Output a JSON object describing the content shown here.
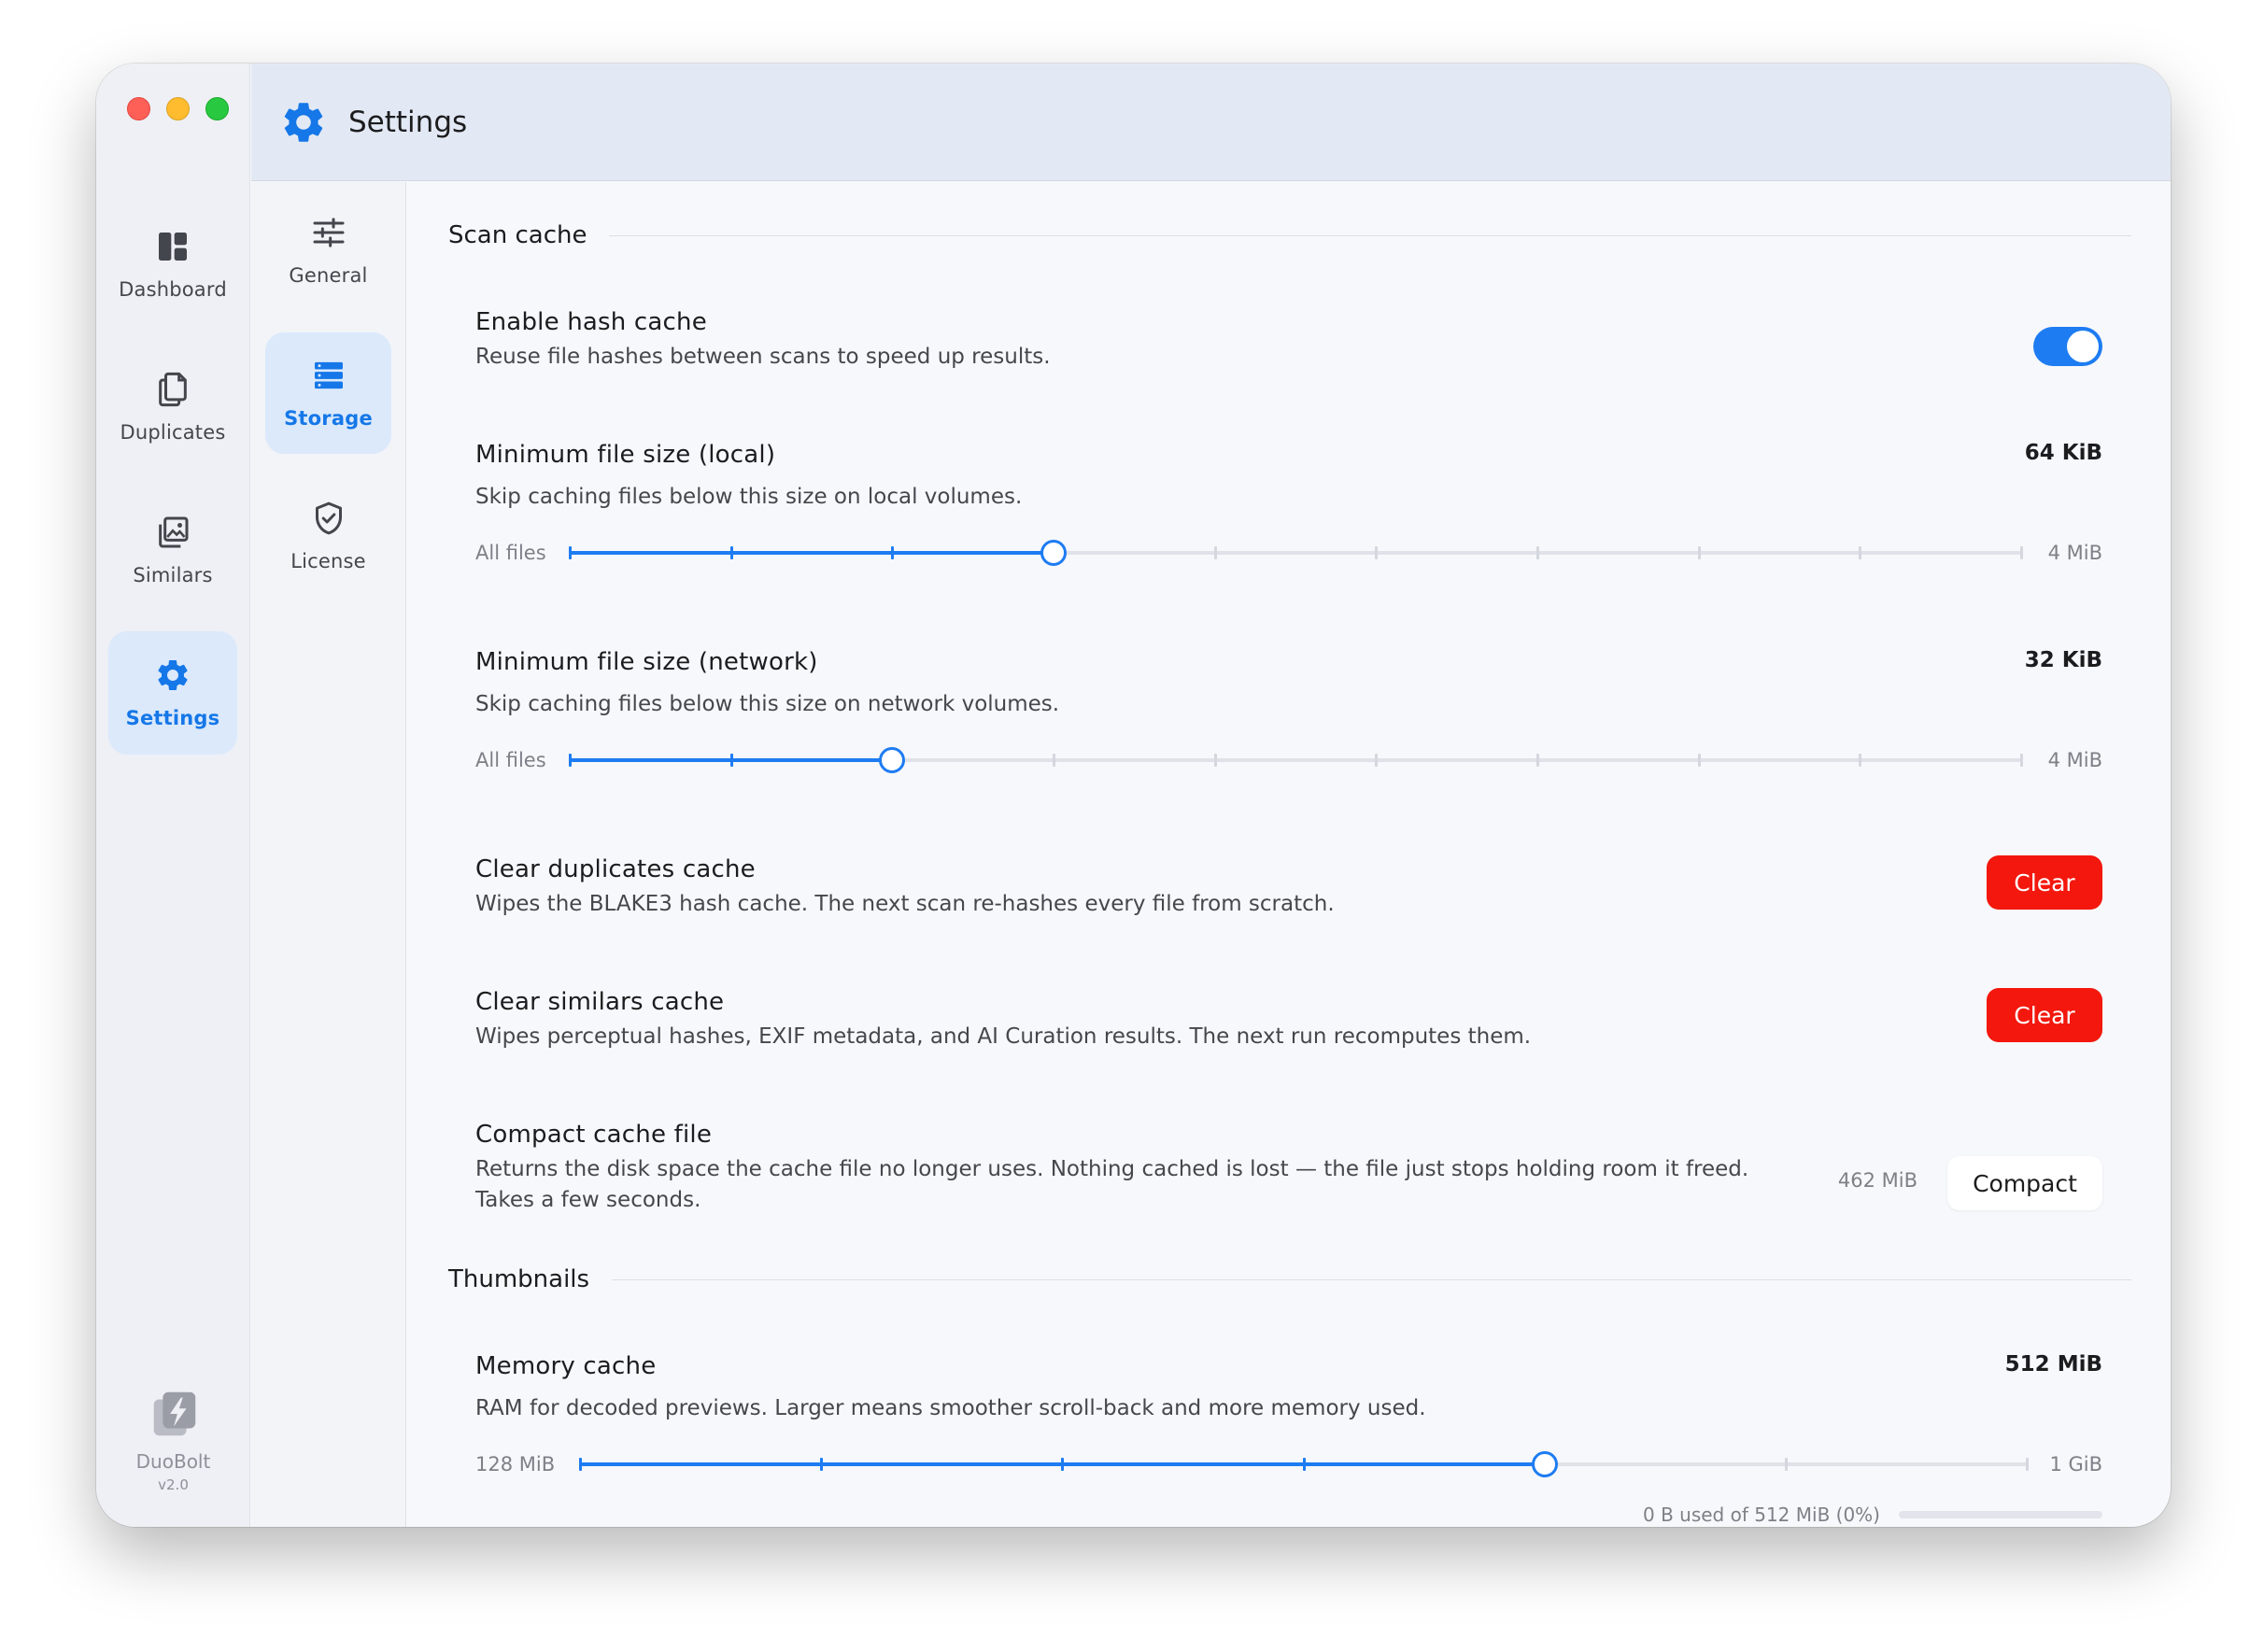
{
  "window": {
    "title": "Settings"
  },
  "sidebar": {
    "items": [
      {
        "label": "Dashboard",
        "icon": "dashboard-icon"
      },
      {
        "label": "Duplicates",
        "icon": "duplicates-icon"
      },
      {
        "label": "Similars",
        "icon": "similars-icon"
      },
      {
        "label": "Settings",
        "icon": "gear-icon",
        "active": true
      }
    ],
    "brand": {
      "name": "DuoBolt",
      "version": "v2.0",
      "icon": "duobolt-logo-icon"
    }
  },
  "subnav": {
    "items": [
      {
        "label": "General",
        "icon": "sliders-icon"
      },
      {
        "label": "Storage",
        "icon": "storage-icon",
        "active": true
      },
      {
        "label": "License",
        "icon": "shield-check-icon"
      }
    ]
  },
  "scan_cache": {
    "title": "Scan cache",
    "hash_cache": {
      "title": "Enable hash cache",
      "desc": "Reuse file hashes between scans to speed up results.",
      "enabled": true
    },
    "min_local": {
      "title": "Minimum file size (local)",
      "desc": "Skip caching files below this size on local volumes.",
      "value": "64 KiB",
      "min_label": "All files",
      "max_label": "4 MiB",
      "stops": 10,
      "position": 3
    },
    "min_network": {
      "title": "Minimum file size (network)",
      "desc": "Skip caching files below this size on network volumes.",
      "value": "32 KiB",
      "min_label": "All files",
      "max_label": "4 MiB",
      "stops": 10,
      "position": 2
    },
    "clear_duplicates": {
      "title": "Clear duplicates cache",
      "desc": "Wipes the BLAKE3 hash cache. The next scan re-hashes every file from scratch.",
      "button": "Clear"
    },
    "clear_similars": {
      "title": "Clear similars cache",
      "desc": "Wipes perceptual hashes, EXIF metadata, and AI Curation results. The next run recomputes them.",
      "button": "Clear"
    },
    "compact": {
      "title": "Compact cache file",
      "desc": "Returns the disk space the cache file no longer uses. Nothing cached is lost — the file just stops holding room it freed. Takes a few seconds.",
      "size": "462 MiB",
      "button": "Compact"
    }
  },
  "thumbnails": {
    "title": "Thumbnails",
    "memory_cache": {
      "title": "Memory cache",
      "desc": "RAM for decoded previews. Larger means smoother scroll-back and more memory used.",
      "value": "512 MiB",
      "min_label": "128 MiB",
      "max_label": "1 GiB",
      "stops": 7,
      "position": 4,
      "usage_text": "0 B used of 512 MiB (0%)",
      "usage_fraction": 0
    }
  },
  "colors": {
    "accent": "#1e7cf2",
    "danger": "#f3170d",
    "active_bg": "#dbe9fb"
  }
}
